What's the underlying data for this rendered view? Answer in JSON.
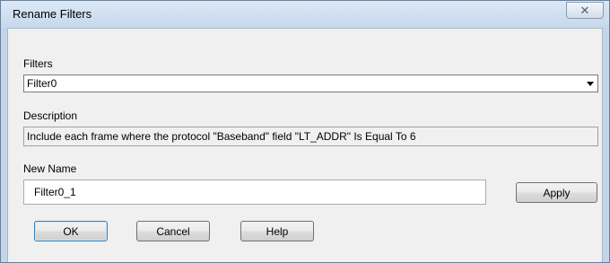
{
  "window": {
    "title": "Rename Filters",
    "close_glyph": "✕"
  },
  "filters": {
    "label": "Filters",
    "selected": "Filter0"
  },
  "description": {
    "label": "Description",
    "text": "Include each frame where the protocol \"Baseband\" field \"LT_ADDR\" Is Equal To 6"
  },
  "new_name": {
    "label": "New Name",
    "value": "Filter0_1"
  },
  "buttons": {
    "apply": "Apply",
    "ok": "OK",
    "cancel": "Cancel",
    "help": "Help"
  },
  "icons": {
    "close": "close-icon",
    "dropdown": "chevron-down-icon"
  },
  "colors": {
    "title_bar": "#c7d8ec",
    "client_bg": "#f0f0f0",
    "default_button_border": "#3c7fb1"
  }
}
